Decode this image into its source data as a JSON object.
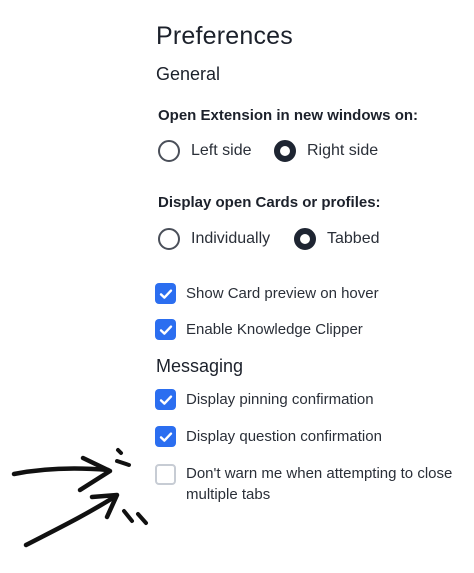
{
  "title": "Preferences",
  "general": {
    "heading": "General",
    "extension_window": {
      "label": "Open Extension in new windows on:",
      "options": [
        {
          "label": "Left side",
          "selected": false
        },
        {
          "label": "Right side",
          "selected": true
        }
      ]
    },
    "card_display": {
      "label": "Display open Cards or profiles:",
      "options": [
        {
          "label": "Individually",
          "selected": false
        },
        {
          "label": "Tabbed",
          "selected": true
        }
      ]
    },
    "checkboxes": [
      {
        "label": "Show Card preview on hover",
        "checked": true
      },
      {
        "label": "Enable Knowledge Clipper",
        "checked": true
      }
    ]
  },
  "messaging": {
    "heading": "Messaging",
    "checkboxes": [
      {
        "label": "Display pinning confirmation",
        "checked": true
      },
      {
        "label": "Display question confirmation",
        "checked": true
      },
      {
        "label": "Don't warn me when attempting to close multiple tabs",
        "checked": false
      }
    ]
  },
  "colors": {
    "accent": "#2b6ef0",
    "radio_selected": "#1e2532",
    "text": "#1c212b",
    "annotation": "#111111"
  },
  "icons": {
    "check": "checkmark-icon",
    "annotation": "hand-drawn-arrows"
  }
}
